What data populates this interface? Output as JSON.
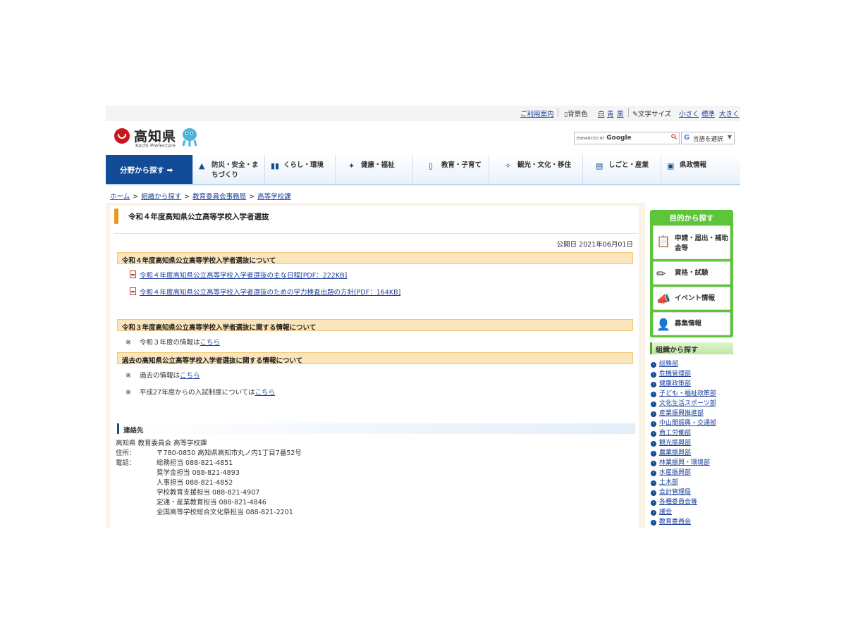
{
  "utility": {
    "guide": "ご利用案内",
    "bgcolor_label": "背景色",
    "bg_options": [
      "白",
      "青",
      "黒"
    ],
    "fontsize_label": "文字サイズ",
    "fontsize_options": [
      "小さく",
      "標準",
      "大きく"
    ]
  },
  "header": {
    "logo_jp": "高知県",
    "logo_en": "Kochi Prefecture",
    "search_prefix": "ENHANCED BY",
    "search_brand": "Google",
    "translate_label": "言語を選択",
    "translate_g": "G"
  },
  "nav": {
    "first": "分野から探す ➡",
    "items": [
      {
        "label": "防災・安全・まちづくり",
        "icon": "▲"
      },
      {
        "label": "くらし・環境",
        "icon": "▮▮"
      },
      {
        "label": "健康・福祉",
        "icon": "✦"
      },
      {
        "label": "教育・子育て",
        "icon": "▯"
      },
      {
        "label": "観光・文化・移住",
        "icon": "✧"
      },
      {
        "label": "しごと・産業",
        "icon": "▤"
      },
      {
        "label": "県政情報",
        "icon": "▣"
      }
    ]
  },
  "breadcrumb": [
    "ホーム",
    "組織から探す",
    "教育委員会事務局",
    "高等学校課"
  ],
  "breadcrumb_sep": ">",
  "page": {
    "title": "令和４年度高知県公立高等学校入学者選抜",
    "pubdate": "公開日 2021年06月01日",
    "sections": [
      {
        "heading": "令和４年度高知県公立高等学校入学者選抜について",
        "links": [
          "令和４年度高知県公立高等学校入学者選抜の主な日程[PDF：222KB]",
          "令和４年度高知県公立高等学校入学者選抜のための学力検査出題の方針[PDF：164KB]"
        ]
      },
      {
        "heading": "令和３年度高知県公立高等学校入学者選抜に関する情報について",
        "notes": [
          {
            "mark": "※",
            "text": "令和３年度の情報は",
            "link": "こちら"
          }
        ]
      },
      {
        "heading": "過去の高知県公立高等学校入学者選抜に関する情報について",
        "notes": [
          {
            "mark": "※",
            "text": "過去の情報は",
            "link": "こちら"
          },
          {
            "mark": "※",
            "text": "平成27年度からの入試制度については",
            "link": "こちら"
          }
        ]
      }
    ]
  },
  "contact": {
    "heading": "連絡先",
    "org": "高知県 教育委員会 高等学校課",
    "address_label": "住所：",
    "address": "〒780-0850 高知県高知市丸ノ内1丁目7番52号",
    "phone_label": "電話：",
    "phones": [
      "総務担当 088-821-4851",
      "奨学金担当 088-821-4893",
      "人事担当 088-821-4852",
      "学校教育支援担当 088-821-4907",
      "定通・産業教育担当 088-821-4846",
      "全国高等学校総合文化祭担当 088-821-2201"
    ]
  },
  "sidebar": {
    "purpose_title": "目的から探す",
    "purpose": [
      {
        "label": "申請・届出・補助金等",
        "icon": "📋"
      },
      {
        "label": "資格・試験",
        "icon": "✏"
      },
      {
        "label": "イベント情報",
        "icon": "📣"
      },
      {
        "label": "募集情報",
        "icon": "👤"
      }
    ],
    "org_title": "組織から探す",
    "org": [
      "総務部",
      "危機管理部",
      "健康政策部",
      "子ども・福祉政策部",
      "文化生活スポーツ部",
      "産業振興推進部",
      "中山間振興・交通部",
      "商工労働部",
      "観光振興部",
      "農業振興部",
      "林業振興・環境部",
      "水産振興部",
      "土木部",
      "会計管理局",
      "各種委員会等",
      "議会",
      "教育委員会"
    ]
  },
  "colors": {
    "nav_active": "#124b96",
    "section_bg": "#fbe5bd",
    "sidebar_green": "#5dc53a",
    "link": "#1a3e9c"
  }
}
